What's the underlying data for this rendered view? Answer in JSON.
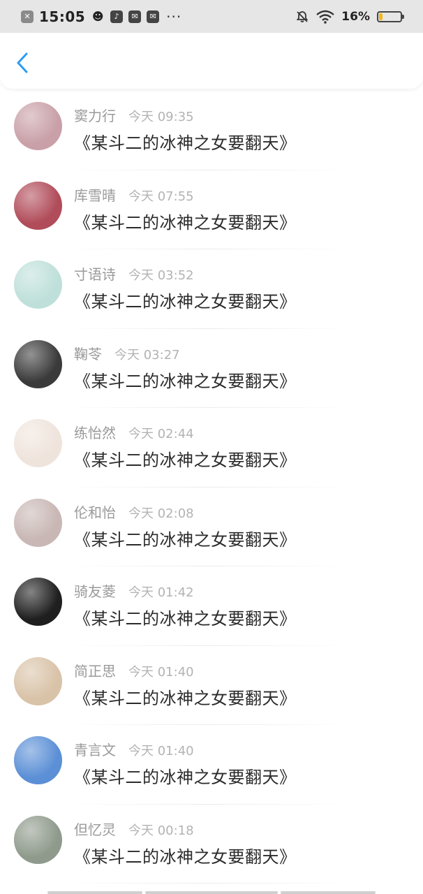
{
  "status_bar": {
    "time": "15:05",
    "battery_percent": "16%",
    "battery_level": 0.16,
    "icons": [
      "close-icon",
      "cat-icon",
      "tiktok-icon",
      "mail-icon",
      "mail-icon",
      "more-dots-icon",
      "mute-icon",
      "wifi-icon",
      "battery-icon"
    ],
    "colors": {
      "battery_fill": "#f3b71a"
    }
  },
  "header": {
    "back_icon": "chevron-left-icon",
    "accent": "#2a9df4"
  },
  "comments": [
    {
      "name": "窦力行",
      "time": "今天 09:35",
      "text": "《某斗二的冰神之女要翻天》",
      "avatar_color": "#c9a0a8"
    },
    {
      "name": "库雪晴",
      "time": "今天 07:55",
      "text": "《某斗二的冰神之女要翻天》",
      "avatar_color": "#b14c5a"
    },
    {
      "name": "寸语诗",
      "time": "今天 03:52",
      "text": "《某斗二的冰神之女要翻天》",
      "avatar_color": "#bfe0da"
    },
    {
      "name": "鞠苓",
      "time": "今天 03:27",
      "text": "《某斗二的冰神之女要翻天》",
      "avatar_color": "#3a3a3a"
    },
    {
      "name": "练怡然",
      "time": "今天 02:44",
      "text": "《某斗二的冰神之女要翻天》",
      "avatar_color": "#efe4dc"
    },
    {
      "name": "伦和怡",
      "time": "今天 02:08",
      "text": "《某斗二的冰神之女要翻天》",
      "avatar_color": "#c8b7b4"
    },
    {
      "name": "骑友菱",
      "time": "今天 01:42",
      "text": "《某斗二的冰神之女要翻天》",
      "avatar_color": "#1f1f1f"
    },
    {
      "name": "简正思",
      "time": "今天 01:40",
      "text": "《某斗二的冰神之女要翻天》",
      "avatar_color": "#d9c3a8"
    },
    {
      "name": "青言文",
      "time": "今天 01:40",
      "text": "《某斗二的冰神之女要翻天》",
      "avatar_color": "#5b8fd6"
    },
    {
      "name": "但忆灵",
      "time": "今天 00:18",
      "text": "《某斗二的冰神之女要翻天》",
      "avatar_color": "#8f9a8c"
    }
  ]
}
